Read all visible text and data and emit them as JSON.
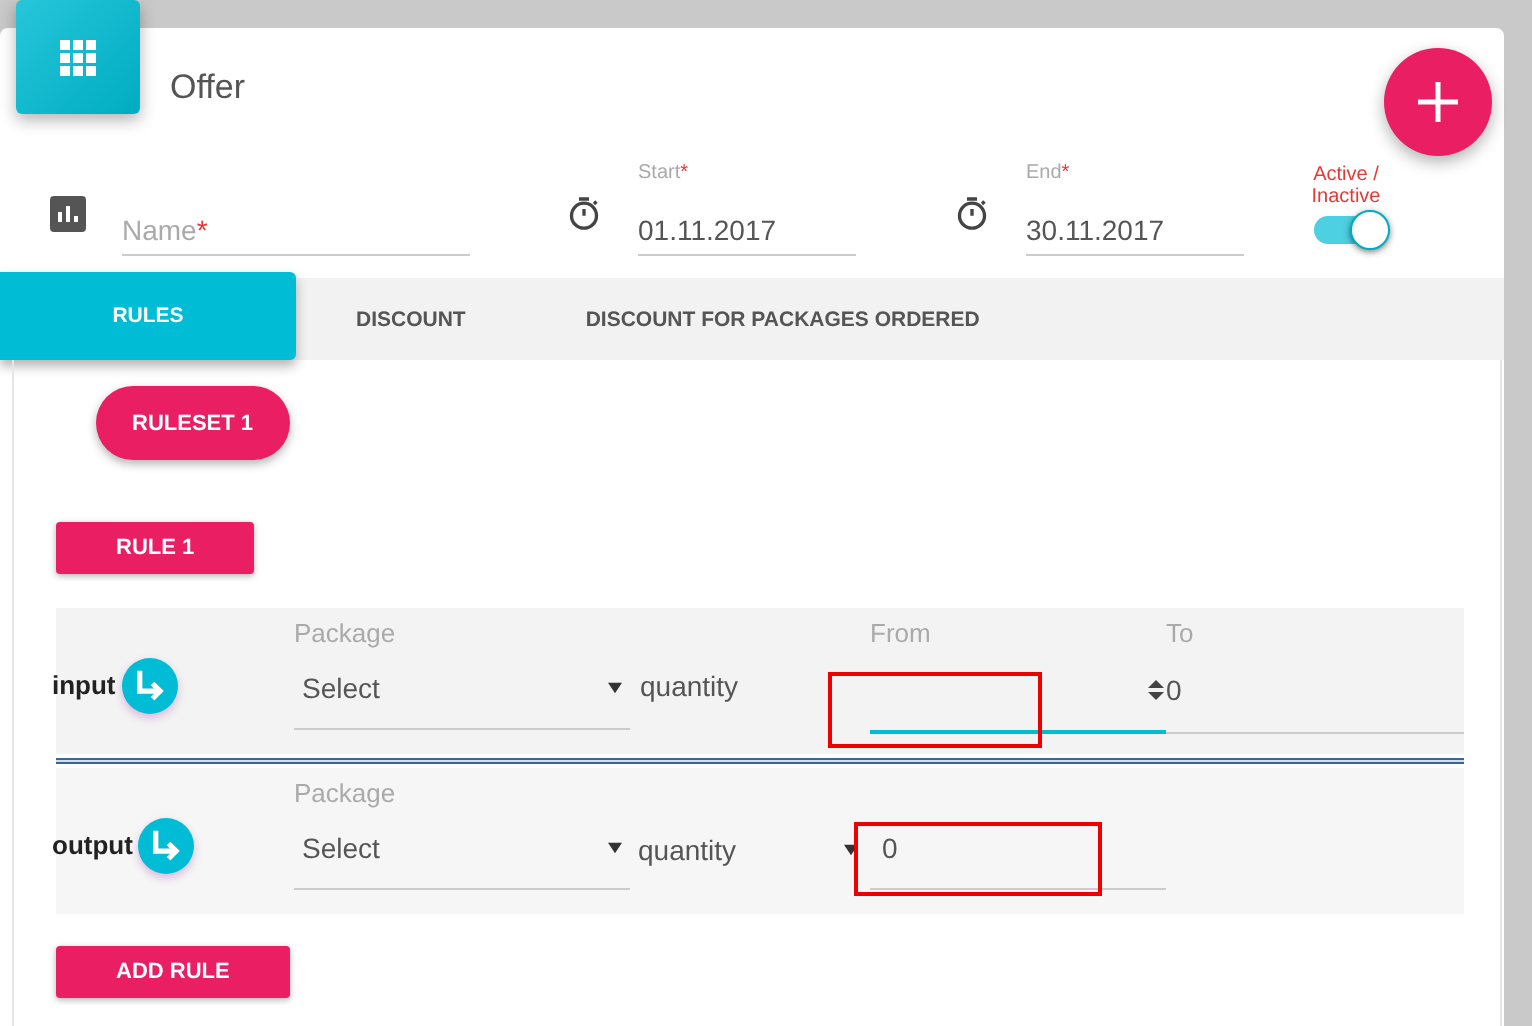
{
  "header": {
    "title": "Offer"
  },
  "name_field": {
    "placeholder": "Name",
    "required_mark": "*"
  },
  "start_field": {
    "label": "Start",
    "required_mark": "*",
    "value": "01.11.2017"
  },
  "end_field": {
    "label": "End",
    "required_mark": "*",
    "value": "30.11.2017"
  },
  "status_toggle": {
    "label": "Active / Inactive",
    "on": true
  },
  "tabs": [
    {
      "label": "RULES",
      "selected": true
    },
    {
      "label": "DISCOUNT",
      "selected": false
    },
    {
      "label": "DISCOUNT FOR PACKAGES ORDERED",
      "selected": false
    }
  ],
  "rulesets": [
    {
      "label": "RULESET 1"
    }
  ],
  "rules": [
    {
      "label": "RULE 1"
    }
  ],
  "sections": [
    {
      "kind": "input",
      "label": "input",
      "package_label": "Package",
      "select_value": "Select",
      "quantity_label": "quantity",
      "from_label": "From",
      "from_focused": true,
      "to_label": "To",
      "to_value": "0"
    },
    {
      "kind": "output",
      "label": "output",
      "package_label": "Package",
      "select_value": "Select",
      "quantity_label": "quantity",
      "value": "0"
    }
  ],
  "add_rule_button": "ADD RULE"
}
